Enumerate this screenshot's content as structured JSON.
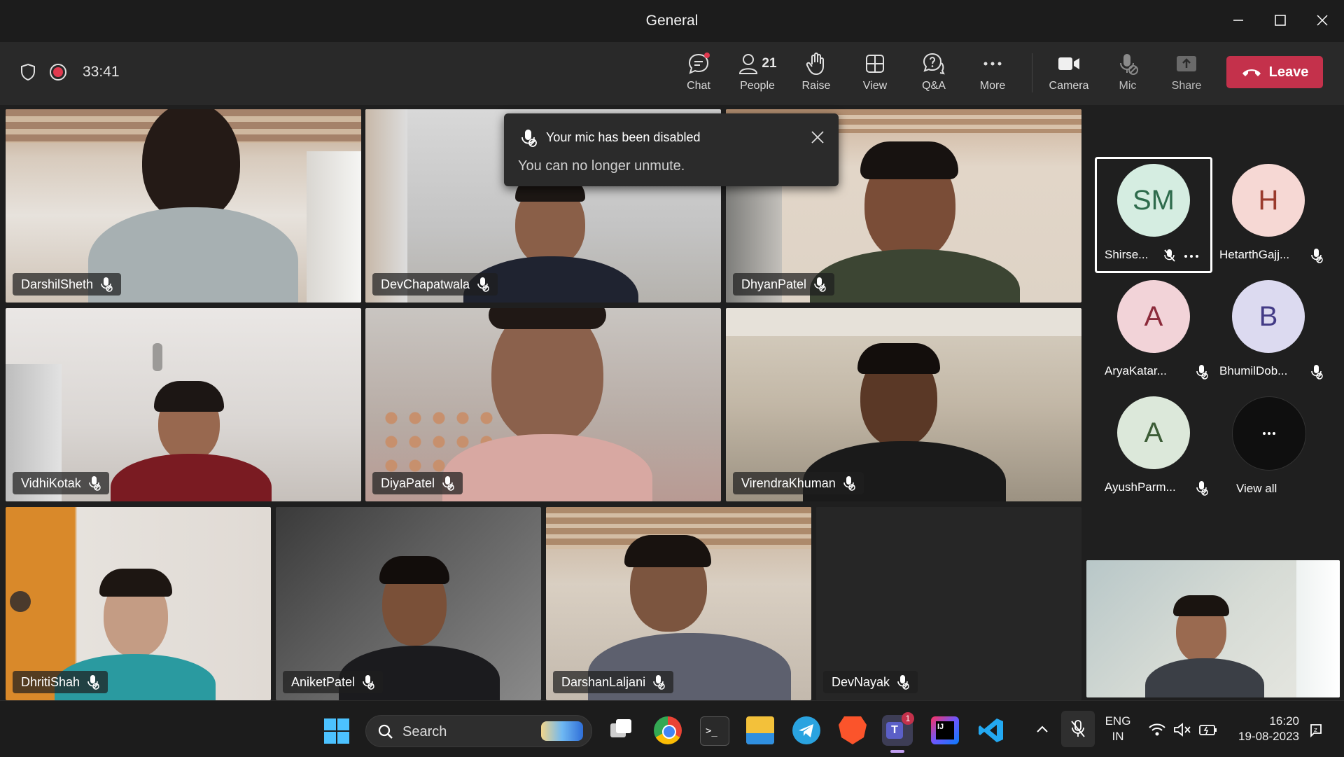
{
  "window": {
    "title": "General"
  },
  "toolbar": {
    "timer": "33:41",
    "chat": "Chat",
    "people": "People",
    "people_count": "21",
    "raise": "Raise",
    "view": "View",
    "qa": "Q&A",
    "more": "More",
    "camera": "Camera",
    "mic": "Mic",
    "share": "Share",
    "leave": "Leave"
  },
  "toast": {
    "title": "Your mic has been disabled",
    "message": "You can no longer unmute."
  },
  "participants": [
    {
      "name": "DarshilSheth"
    },
    {
      "name": "DevChapatwala"
    },
    {
      "name": "DhyanPatel"
    },
    {
      "name": "VidhiKotak"
    },
    {
      "name": "DiyaPatel"
    },
    {
      "name": "VirendraKhuman"
    },
    {
      "name": "DhritiShah"
    },
    {
      "name": "AniketPatel"
    },
    {
      "name": "DarshanLaljani"
    },
    {
      "name": "DevNayak"
    }
  ],
  "sidebar": {
    "people": [
      {
        "initials": "SM",
        "name": "Shirse...",
        "color": "#d5ede1",
        "text_color": "#2e6b4c"
      },
      {
        "initials": "H",
        "name": "HetarthGajj...",
        "color": "#f6d8d4",
        "text_color": "#9a3a2c"
      },
      {
        "initials": "A",
        "name": "AryaKatar...",
        "color": "#f2d3d8",
        "text_color": "#8b2a3a"
      },
      {
        "initials": "B",
        "name": "BhumilDob...",
        "color": "#dcdaf0",
        "text_color": "#433b86"
      },
      {
        "initials": "A",
        "name": "AyushParm...",
        "color": "#dce8da",
        "text_color": "#3c5c36"
      }
    ],
    "view_all": "View all"
  },
  "taskbar": {
    "search": "Search",
    "teams_badge": "1",
    "lang": "ENG",
    "region": "IN",
    "time": "16:20",
    "date": "19-08-2023"
  },
  "colors": {
    "leave": "#c4314b",
    "record_dot": "#e0394f"
  }
}
